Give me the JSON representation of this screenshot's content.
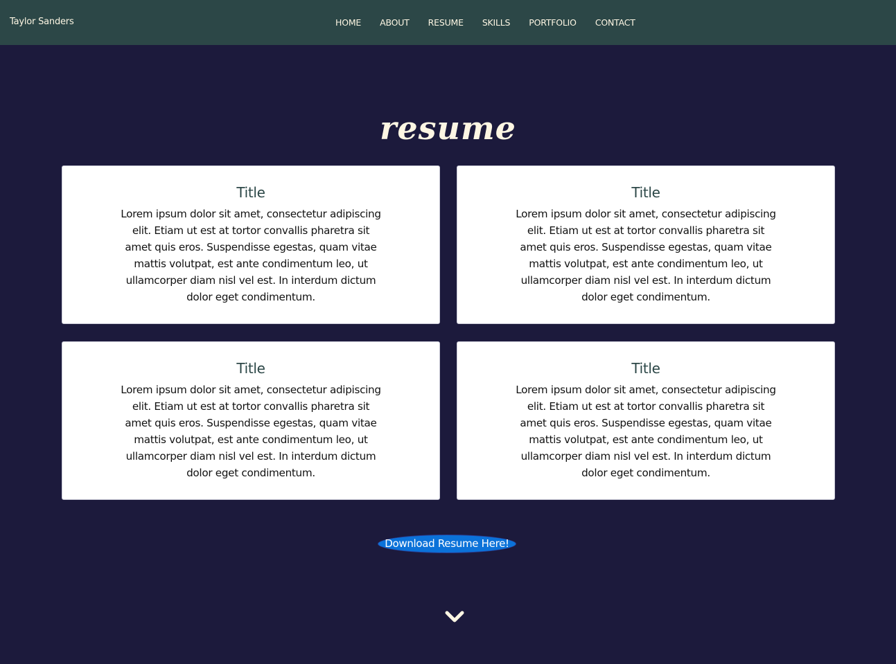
{
  "header": {
    "brand": "Taylor Sanders",
    "nav": [
      {
        "label": "HOME"
      },
      {
        "label": "ABOUT"
      },
      {
        "label": "RESUME"
      },
      {
        "label": "SKILLS"
      },
      {
        "label": "PORTFOLIO"
      },
      {
        "label": "CONTACT"
      }
    ]
  },
  "section": {
    "title": "resume"
  },
  "cards": [
    {
      "title": "Title",
      "body": "Lorem ipsum dolor sit amet, consectetur adipiscing elit. Etiam ut est at tortor convallis pharetra sit amet quis eros. Suspendisse egestas, quam vitae mattis volutpat, est ante condimentum leo, ut ullamcorper diam nisl vel est. In interdum dictum dolor eget condimentum."
    },
    {
      "title": "Title",
      "body": "Lorem ipsum dolor sit amet, consectetur adipiscing elit. Etiam ut est at tortor convallis pharetra sit amet quis eros. Suspendisse egestas, quam vitae mattis volutpat, est ante condimentum leo, ut ullamcorper diam nisl vel est. In interdum dictum dolor eget condimentum."
    },
    {
      "title": "Title",
      "body": "Lorem ipsum dolor sit amet, consectetur adipiscing elit. Etiam ut est at tortor convallis pharetra sit amet quis eros. Suspendisse egestas, quam vitae mattis volutpat, est ante condimentum leo, ut ullamcorper diam nisl vel est. In interdum dictum dolor eget condimentum."
    },
    {
      "title": "Title",
      "body": "Lorem ipsum dolor sit amet, consectetur adipiscing elit. Etiam ut est at tortor convallis pharetra sit amet quis eros. Suspendisse egestas, quam vitae mattis volutpat, est ante condimentum leo, ut ullamcorper diam nisl vel est. In interdum dictum dolor eget condimentum."
    }
  ],
  "download_button": {
    "label": "Download Resume Here!"
  },
  "scroll_indicator": {
    "icon": "chevron-down-icon"
  },
  "colors": {
    "background": "#1c1a3c",
    "navbar": "#2c4747",
    "accent_text": "#fdf6e3",
    "card_title": "#2c4747",
    "button": "#0b72d9"
  }
}
